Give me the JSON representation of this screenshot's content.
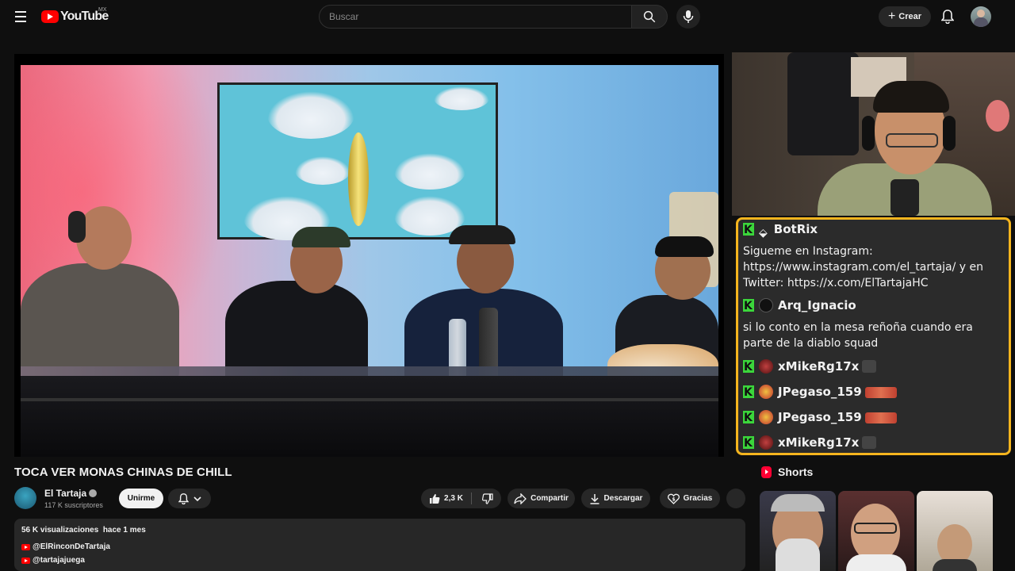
{
  "masthead": {
    "logo_text": "YouTube",
    "country_code": "MX",
    "search_placeholder": "Buscar",
    "create_label": "Crear",
    "icons": [
      "menu-icon",
      "search-icon",
      "mic-icon",
      "plus-icon",
      "bell-icon"
    ]
  },
  "chat": {
    "border_color": "#f5b51e",
    "messages": [
      {
        "user": "BotRix",
        "badge": "bot",
        "text": "Sigueme en Instagram: https://www.instagram.com/el_tartaja/ y en Twitter: https://x.com/ElTartajaHC"
      },
      {
        "user": "Arq_Ignacio",
        "badge": "default",
        "text": "si lo conto en la mesa reñoña cuando era parte de la diablo squad"
      },
      {
        "user": "xMikeRg17x",
        "badge": "avatar",
        "text": ""
      },
      {
        "user": "JPegaso_159",
        "badge": "avatar",
        "text": ""
      },
      {
        "user": "JPegaso_159",
        "badge": "avatar",
        "text": ""
      },
      {
        "user": "xMikeRg17x",
        "badge": "avatar",
        "text": ""
      }
    ]
  },
  "video": {
    "title": "TOCA VER MONAS CHINAS DE CHILL",
    "channel": "El Tartaja",
    "subscribers": "117 K suscriptores",
    "join_label": "Unirme",
    "likes": "2,3 K",
    "share_label": "Compartir",
    "download_label": "Descargar",
    "thanks_label": "Gracias"
  },
  "description": {
    "stats": "56 K visualizaciones  hace 1 mes",
    "links": [
      "@ElRinconDeTartaja",
      "@tartajajuega"
    ]
  },
  "shorts": {
    "label": "Shorts"
  }
}
